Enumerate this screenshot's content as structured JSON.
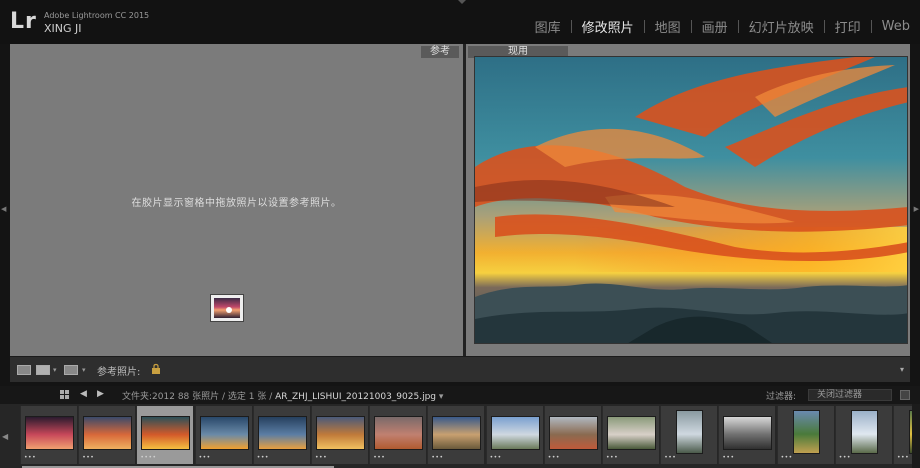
{
  "app": {
    "logo": "Lr",
    "version": "Adobe Lightroom CC 2015",
    "user": "XING JI"
  },
  "modules": [
    {
      "label": "图库",
      "active": false
    },
    {
      "label": "修改照片",
      "active": true
    },
    {
      "label": "地图",
      "active": false
    },
    {
      "label": "画册",
      "active": false
    },
    {
      "label": "幻灯片放映",
      "active": false
    },
    {
      "label": "打印",
      "active": false
    },
    {
      "label": "Web",
      "active": false
    }
  ],
  "compare": {
    "reference_tab": "参考",
    "active_tab": "现用",
    "reference_hint": "在胶片显示窗格中拖放照片以设置参考照片。"
  },
  "toolbar": {
    "reference_photo_label": "参考照片:"
  },
  "filmstrip_header": {
    "source_prefix": "文件夹:2012",
    "source_counts": "88 张照片 / 选定 1 张 /",
    "filename": "AR_ZHJ_LISHUI_20121003_9025.jpg",
    "filter_label": "过滤器:",
    "filter_value": "关闭过滤器"
  },
  "filmstrip": {
    "thumbs": [
      {
        "orient": "land",
        "c1": "#2a1b2e",
        "c2": "#c8485a",
        "c3": "#f0a070",
        "dots": "•••"
      },
      {
        "orient": "land",
        "c1": "#3a4a6a",
        "c2": "#d8683a",
        "c3": "#f0b060",
        "dots": "•••"
      },
      {
        "orient": "land",
        "c1": "#2c5058",
        "c2": "#d35a2a",
        "c3": "#f5c040",
        "dots": "••••",
        "selected": true
      },
      {
        "orient": "land",
        "c1": "#29486a",
        "c2": "#6a8aa8",
        "c3": "#f0a030",
        "dots": "•••"
      },
      {
        "orient": "land",
        "c1": "#26405e",
        "c2": "#5c7ea4",
        "c3": "#e8a040",
        "dots": "•••"
      },
      {
        "orient": "land",
        "c1": "#4a5a7a",
        "c2": "#c07a3a",
        "c3": "#f0c060",
        "dots": "•••"
      },
      {
        "orient": "land",
        "c1": "#7a6a6a",
        "c2": "#c08070",
        "c3": "#b05a30",
        "dots": "•••"
      },
      {
        "orient": "land",
        "c1": "#3a5a8a",
        "c2": "#c8a070",
        "c3": "#6a5a3a",
        "dots": "•••"
      },
      {
        "orient": "land",
        "c1": "#7aa0d0",
        "c2": "#cfd8e0",
        "c3": "#6a7a5a",
        "dots": "•••"
      },
      {
        "orient": "land",
        "c1": "#b0b8c0",
        "c2": "#8a6a50",
        "c3": "#c05a3a",
        "dots": "•••"
      },
      {
        "orient": "land",
        "c1": "#8a9a7a",
        "c2": "#d8d0c8",
        "c3": "#4a5a3a",
        "dots": "•••"
      },
      {
        "orient": "port",
        "c1": "#8a9aa0",
        "c2": "#cfd8e0",
        "c3": "#4a5a4a",
        "dots": "•••"
      },
      {
        "orient": "land",
        "c1": "#d8d8d8",
        "c2": "#707070",
        "c3": "#303030",
        "dots": "•••"
      },
      {
        "orient": "port",
        "c1": "#6a8ab0",
        "c2": "#4a7a3a",
        "c3": "#c0a050",
        "dots": "•••"
      },
      {
        "orient": "port",
        "c1": "#9ab0c8",
        "c2": "#e0e8f0",
        "c3": "#5a6a4a",
        "dots": "•••"
      },
      {
        "orient": "port",
        "c1": "#5a7a4a",
        "c2": "#e0c040",
        "c3": "#3a4a2a",
        "dots": "•••"
      }
    ]
  }
}
